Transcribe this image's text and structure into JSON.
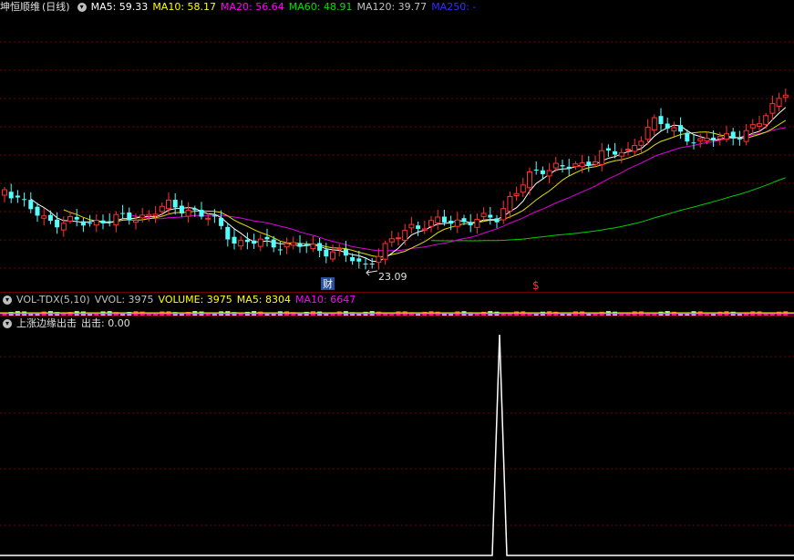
{
  "price": {
    "stock_name": "坤恒顺维",
    "period": "(日线)",
    "ma": [
      {
        "label": "MA5: 59.33",
        "color": "#ffffff"
      },
      {
        "label": "MA10: 58.17",
        "color": "#ffff00"
      },
      {
        "label": "MA20: 56.64",
        "color": "#ff00ff"
      },
      {
        "label": "MA60: 48.91",
        "color": "#00e000"
      },
      {
        "label": "MA120: 39.77",
        "color": "#c0c0c0"
      },
      {
        "label": "MA250: -",
        "color": "#3030ff"
      }
    ],
    "low_price_label": "23.09",
    "event_marker_cai": "财",
    "event_marker_dollar": "$",
    "colors": {
      "up": "#ff3232",
      "down": "#54ffff",
      "grid": "#7a0000"
    }
  },
  "volume": {
    "title": "VOL-TDX(5,10)",
    "vvol": "VVOL: 3975",
    "volume": "VOLUME: 3975",
    "ma5": "MA5: 8304",
    "ma10": "MA10: 6647"
  },
  "indicator": {
    "title": "上涨边缘出击",
    "value": "出击: 0.00"
  }
}
